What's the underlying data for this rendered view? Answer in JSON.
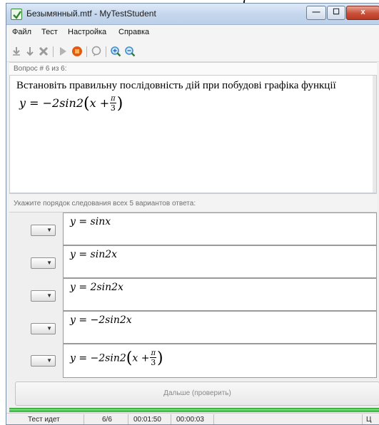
{
  "window": {
    "title": "Безымянный.mtf - MyTestStudent",
    "min_glyph": "—",
    "max_glyph": "☐",
    "close_glyph": "x"
  },
  "menu": {
    "items": [
      "Файл",
      "Тест",
      "Настройка",
      "Справка"
    ]
  },
  "toolbar": {
    "icons": [
      "download-icon",
      "download-alt-icon",
      "delete-icon",
      "play-icon",
      "stop-icon",
      "chat-icon",
      "zoom-in-icon",
      "zoom-out-icon"
    ]
  },
  "question": {
    "counter": "Вопрос # 6 из 6:",
    "text": "Встановіть правильну послідовність дій при побудові графіка функції",
    "formula_prefix": "y = −2sin2",
    "formula_x": "x +",
    "formula_num": "π",
    "formula_den": "3"
  },
  "answers": {
    "instruction": "Укажите порядок следования всех 5 вариантов ответа:",
    "select_arrow": "▼",
    "items": [
      {
        "formula": "y = sinx"
      },
      {
        "formula": "y = sin2x"
      },
      {
        "formula": "y = 2sin2x"
      },
      {
        "formula": "y = −2sin2x"
      },
      {
        "prefix": "y = −2sin2",
        "x_part": "x +",
        "num": "π",
        "den": "3"
      }
    ]
  },
  "next_button": {
    "label": "Дальше (проверить)"
  },
  "progress": {
    "fraction": 1.0
  },
  "status": {
    "state": "Тест идет",
    "count": "6/6",
    "elapsed": "00:01:50",
    "question_time": "00:00:03",
    "tail": "Ц"
  },
  "colors": {
    "progress_green": "#2fb82f",
    "close_red": "#c9503a",
    "stop_orange": "#e25a12"
  }
}
